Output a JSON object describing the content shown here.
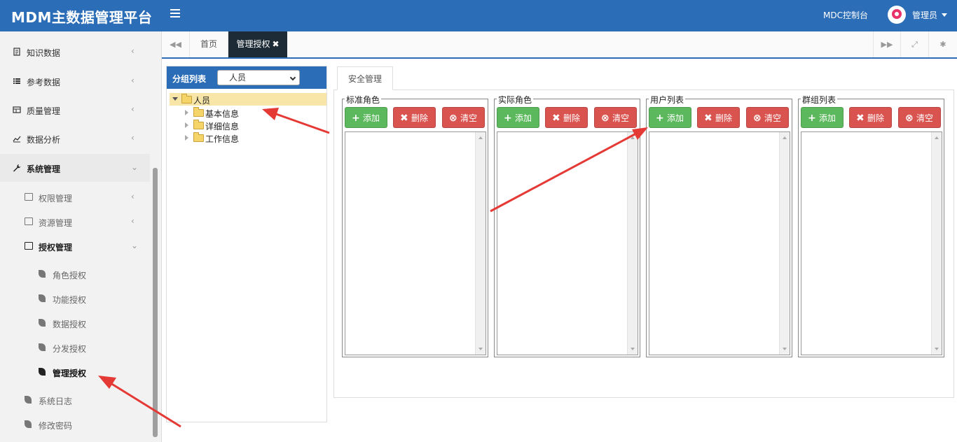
{
  "header": {
    "app_title": "MDM主数据管理平台",
    "mdc_label": "MDC控制台",
    "user_name": "管理员"
  },
  "sidebar": {
    "items": [
      {
        "label": "知识数据",
        "icon": "document-icon"
      },
      {
        "label": "参考数据",
        "icon": "list-icon"
      },
      {
        "label": "质量管理",
        "icon": "table-icon"
      },
      {
        "label": "数据分析",
        "icon": "line-chart-icon"
      },
      {
        "label": "系统管理",
        "icon": "wrench-icon"
      }
    ],
    "sub_items": [
      {
        "label": "权限管理",
        "icon": "folder-icon"
      },
      {
        "label": "资源管理",
        "icon": "folder-icon"
      },
      {
        "label": "授权管理",
        "icon": "folder-icon"
      }
    ],
    "auth_items": [
      {
        "label": "角色授权",
        "icon": "leaf-icon"
      },
      {
        "label": "功能授权",
        "icon": "leaf-icon"
      },
      {
        "label": "数据授权",
        "icon": "leaf-icon"
      },
      {
        "label": "分发授权",
        "icon": "leaf-icon"
      },
      {
        "label": "管理授权",
        "icon": "leaf-icon",
        "active": true
      }
    ],
    "bottom_items": [
      {
        "label": "系统日志",
        "icon": "leaf-icon"
      },
      {
        "label": "修改密码",
        "icon": "leaf-icon"
      }
    ]
  },
  "tabs": {
    "home_label": "首页",
    "current_label": "管理授权",
    "close_glyph": "✖"
  },
  "group_panel": {
    "title": "分组列表",
    "select_value": "人员",
    "tree": {
      "root": "人员",
      "children": [
        "基本信息",
        "详细信息",
        "工作信息"
      ]
    }
  },
  "main": {
    "tab_label": "安全管理",
    "sections": [
      {
        "legend": "标准角色"
      },
      {
        "legend": "实际角色"
      },
      {
        "legend": "用户列表"
      },
      {
        "legend": "群组列表"
      }
    ],
    "buttons": {
      "add": "添加",
      "delete": "删除",
      "clear": "清空"
    }
  },
  "colors": {
    "brand_blue": "#2b6db7",
    "add_green": "#5cb85c",
    "delete_red": "#d9534f",
    "tree_highlight": "#f7e6a8",
    "active_tab": "#1c2b36",
    "annotation_red": "#e53935"
  }
}
